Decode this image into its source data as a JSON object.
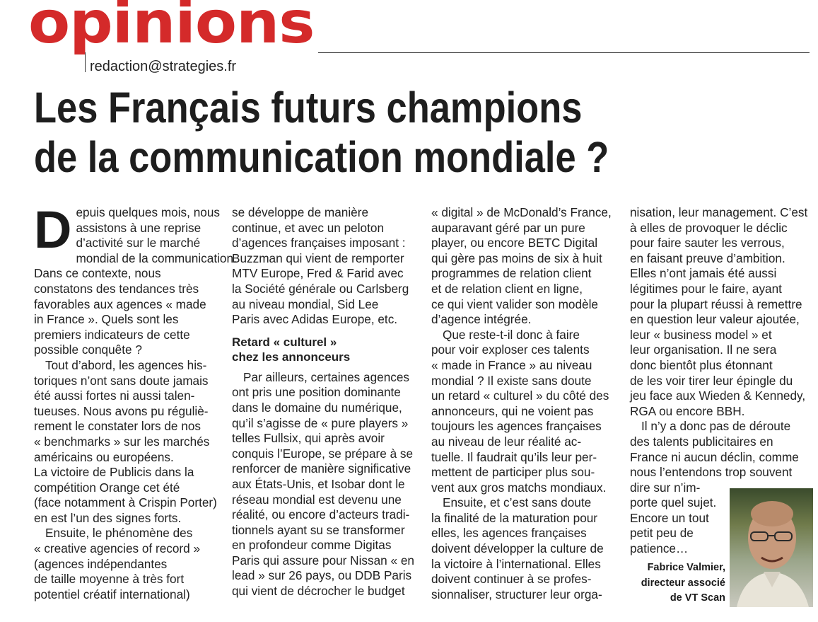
{
  "rubric": "opinions",
  "email": "redaction@strategies.fr",
  "headline": [
    "Les Français futurs champions",
    "de la communication mondiale ?"
  ],
  "col1": {
    "dropcap": "D",
    "lines": [
      "epuis quelques mois, nous",
      "assistons à une reprise",
      "d’activité sur le marché",
      "mondial de la communication.",
      "Dans ce contexte, nous",
      "constatons des tendances très",
      "favorables aux agences « made",
      "in France ». Quels sont les",
      "premiers indicateurs de cette",
      "possible conquête ?",
      "Tout d’abord, les agences his-",
      "toriques n’ont sans doute jamais",
      "été aussi fortes ni aussi talen-",
      "tueuses. Nous avons pu réguliè-",
      "rement le constater lors de nos",
      "« benchmarks » sur les marchés",
      "américains ou européens.",
      "La victoire de Publicis dans la",
      "compétition Orange cet été",
      "(face notamment à Crispin Porter)",
      "en est l’un des signes forts.",
      "Ensuite, le phénomène des",
      "« creative agencies of record »",
      "(agences indépendantes",
      "de taille moyenne à très fort",
      "potentiel créatif international)"
    ]
  },
  "col2": {
    "lines_a": [
      "se développe de manière",
      "continue, et avec un peloton",
      "d’agences françaises imposant :",
      "Buzzman qui vient de remporter",
      "MTV Europe, Fred & Farid avec",
      "la Société générale ou Carlsberg",
      "au niveau mondial, Sid Lee",
      "Paris avec Adidas Europe, etc."
    ],
    "subhead": [
      "Retard « culturel »",
      "chez les annonceurs"
    ],
    "lines_b": [
      "Par ailleurs, certaines agences",
      "ont pris une position dominante",
      "dans le domaine du numérique,",
      "qu’il s’agisse de « pure players »",
      "telles Fullsix, qui après avoir",
      "conquis l’Europe, se prépare à se",
      "renforcer de manière significative",
      "aux États-Unis, et Isobar dont le",
      "réseau mondial est devenu une",
      "réalité, ou encore d’acteurs tradi-",
      "tionnels ayant su se transformer",
      "en profondeur comme Digitas",
      "Paris qui assure pour Nissan « en",
      "lead » sur 26 pays, ou DDB Paris",
      "qui vient de décrocher le budget"
    ]
  },
  "col3": {
    "lines": [
      "« digital » de McDonald’s France,",
      "auparavant géré par un pure",
      "player, ou encore BETC Digital",
      "qui gère pas moins de six à huit",
      "programmes de relation client",
      "et de relation client en ligne,",
      "ce qui vient valider son modèle",
      "d’agence intégrée.",
      "Que reste-t-il donc à faire",
      "pour voir exploser ces talents",
      "« made in France » au niveau",
      "mondial ? Il existe sans doute",
      "un retard « culturel » du côté des",
      "annonceurs, qui ne voient pas",
      "toujours les agences françaises",
      "au niveau de leur réalité ac-",
      "tuelle. Il faudrait qu’ils leur per-",
      "mettent de participer plus sou-",
      "vent aux gros matchs mondiaux.",
      "Ensuite, et c’est sans doute",
      "la finalité de la maturation pour",
      "elles, les agences françaises",
      "doivent développer la culture de",
      "la victoire à l’international. Elles",
      "doivent continuer à se profes-",
      "sionnaliser, structurer leur orga-"
    ]
  },
  "col4": {
    "lines": [
      "nisation, leur management. C’est",
      "à elles de provoquer le déclic",
      "pour faire sauter les verrous,",
      "en faisant preuve d’ambition.",
      "Elles n’ont jamais été aussi",
      "légitimes pour le faire, ayant",
      "pour la plupart réussi à remettre",
      "en question leur valeur ajoutée,",
      "leur « business model » et",
      "leur organisation. Il ne sera",
      "donc bientôt plus étonnant",
      "de les voir tirer leur épingle du",
      "jeu face aux Wieden & Kennedy,",
      "RGA ou encore BBH.",
      "Il n’y a donc pas de déroute",
      "des talents publicitaires en",
      "France ni aucun déclin, comme",
      "nous l’entendons trop souvent",
      "dire sur n’im-",
      "porte quel sujet.",
      "Encore un tout",
      "petit peu de",
      "patience…"
    ]
  },
  "signature": [
    "Fabrice Valmier,",
    "directeur associé",
    "de VT Scan"
  ]
}
